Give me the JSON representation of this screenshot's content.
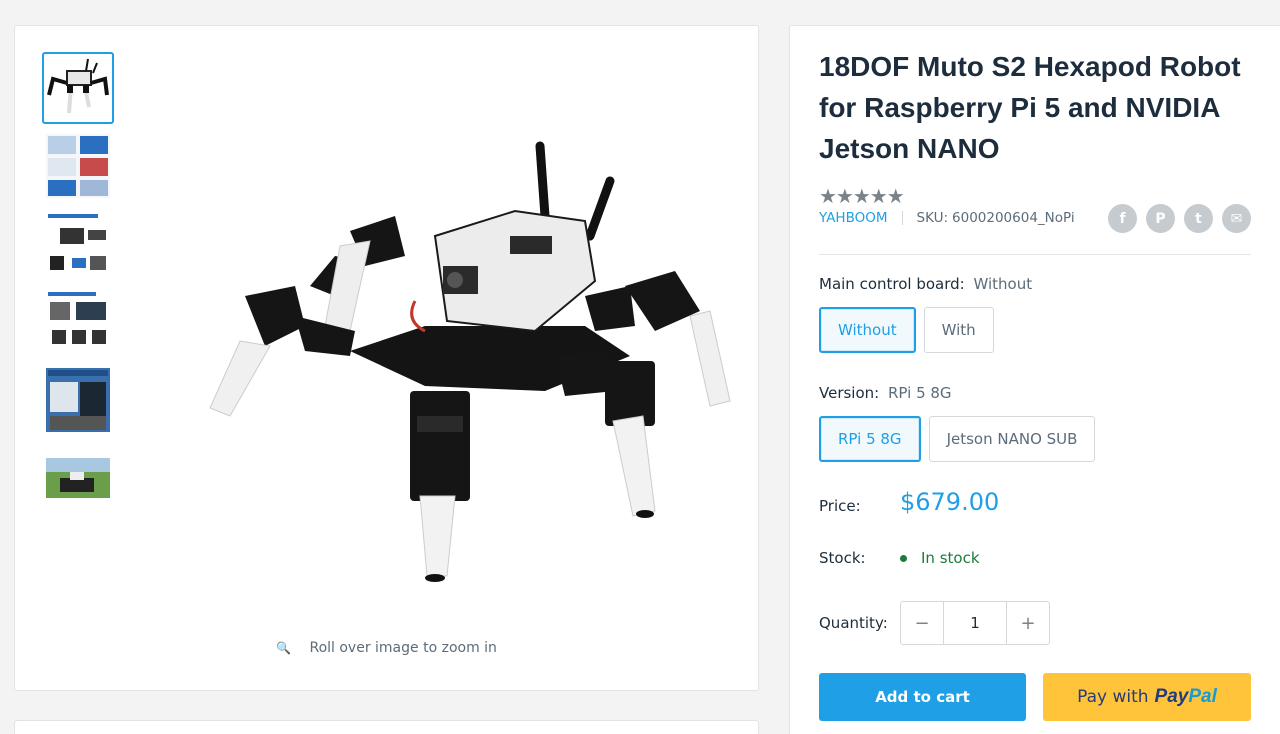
{
  "product": {
    "title": "18DOF Muto S2 Hexapod Robot for Raspberry Pi 5 and NVIDIA Jetson NANO",
    "rating_stars": "★★★★★",
    "rating_value": 5,
    "vendor": "YAHBOOM",
    "sku_label": "SKU:",
    "sku": "6000200604_NoPi"
  },
  "share": {
    "icons": [
      "facebook-icon",
      "pinterest-icon",
      "twitter-icon",
      "email-icon"
    ],
    "glyphs": [
      "f",
      "P",
      "t",
      "✉"
    ]
  },
  "gallery": {
    "thumbnail_count": 6,
    "active_index": 0,
    "zoom_hint": "Roll over image to zoom in",
    "zoom_icon": "🔍"
  },
  "options": {
    "board": {
      "label": "Main control board:",
      "selected": "Without",
      "values": [
        "Without",
        "With"
      ]
    },
    "version": {
      "label": "Version:",
      "selected": "RPi 5 8G",
      "values": [
        "RPi 5 8G",
        "Jetson NANO SUB"
      ]
    }
  },
  "price": {
    "label": "Price:",
    "value": "$679.00"
  },
  "stock": {
    "label": "Stock:",
    "value": "In stock"
  },
  "quantity": {
    "label": "Quantity:",
    "value": "1",
    "minus": "−",
    "plus": "+"
  },
  "buttons": {
    "add_to_cart": "Add to cart",
    "paypal_prefix": "Pay with",
    "paypal_brand_pay": "Pay",
    "paypal_brand_pal": "Pal"
  },
  "colors": {
    "accent": "#1e9fe6",
    "in_stock": "#1c7b3a",
    "paypal_bg": "#ffc439"
  }
}
